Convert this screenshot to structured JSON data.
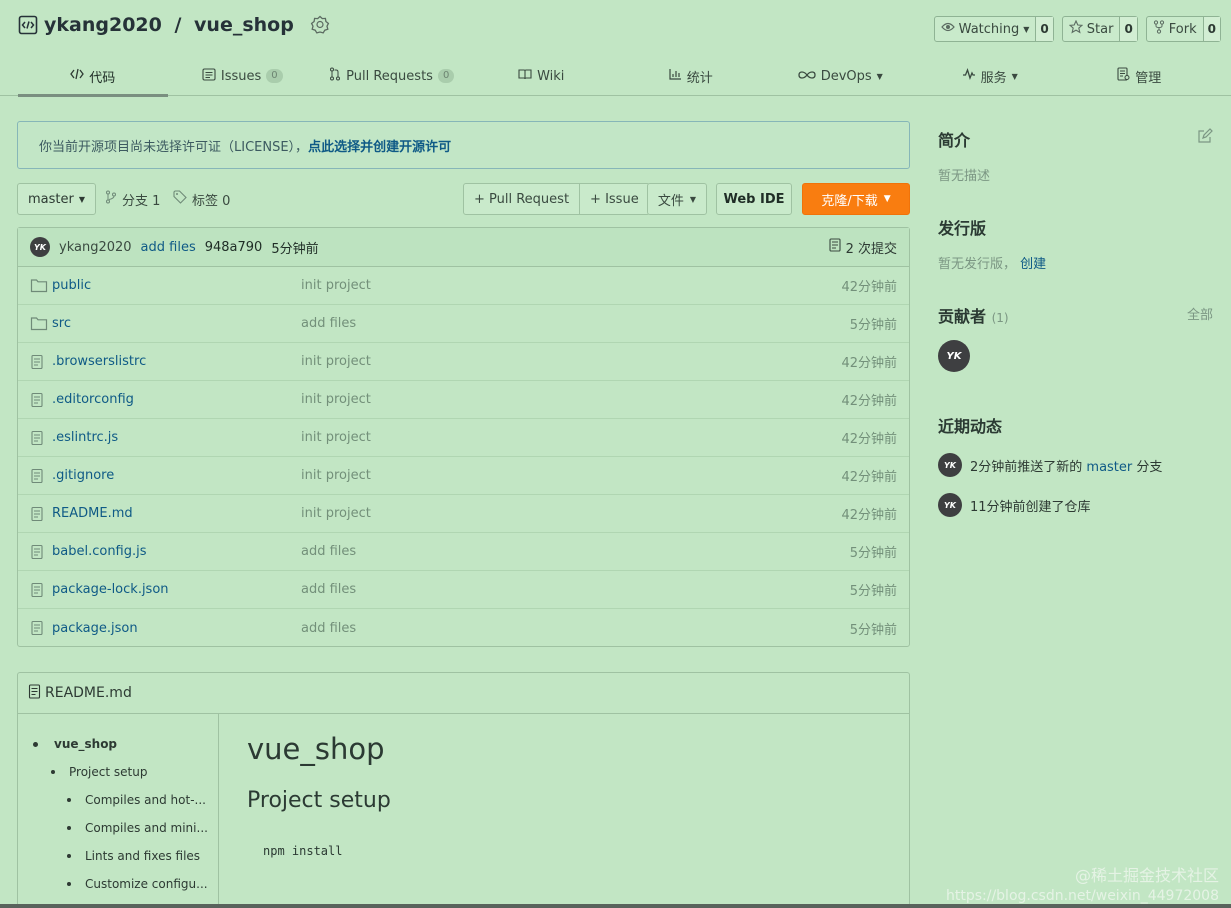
{
  "repo": {
    "owner": "ykang2020",
    "separator": " / ",
    "name": "vue_shop"
  },
  "actions": [
    {
      "label": "Watching",
      "count": "0",
      "icon": "eye-icon",
      "caret": true
    },
    {
      "label": "Star",
      "count": "0",
      "icon": "star-icon",
      "caret": false
    },
    {
      "label": "Fork",
      "count": "0",
      "icon": "fork-icon",
      "caret": false
    }
  ],
  "tabs": [
    {
      "label": "代码",
      "icon": "code-icon"
    },
    {
      "label": "Issues",
      "count": "0",
      "icon": "issues-icon"
    },
    {
      "label": "Pull Requests",
      "count": "0",
      "icon": "pull-request-icon"
    },
    {
      "label": "Wiki",
      "icon": "wiki-icon"
    },
    {
      "label": "统计",
      "icon": "chart-icon"
    },
    {
      "label": "DevOps",
      "icon": "devops-icon"
    },
    {
      "label": "服务",
      "icon": "pulse-icon"
    },
    {
      "label": "管理",
      "icon": "settings-doc-icon"
    }
  ],
  "notice": {
    "text": "你当前开源项目尚未选择许可证（LICENSE），",
    "link": "点此选择并创建开源许可"
  },
  "toolbar": {
    "branch": "master",
    "branches": "分支 1",
    "tags": "标签 0",
    "pull_request": "+ Pull Request",
    "issue": "+ Issue",
    "file": "文件",
    "web_ide": "Web IDE",
    "clone": "克隆/下载"
  },
  "commit": {
    "author": "ykang2020",
    "message": "add files",
    "hash": "948a790",
    "time": "5分钟前",
    "count": "2 次提交"
  },
  "files": [
    {
      "name": "public",
      "type": "folder",
      "message": "init project",
      "time": "42分钟前"
    },
    {
      "name": "src",
      "type": "folder",
      "message": "add files",
      "time": "5分钟前"
    },
    {
      "name": ".browserslistrc",
      "type": "file",
      "message": "init project",
      "time": "42分钟前"
    },
    {
      "name": ".editorconfig",
      "type": "file",
      "message": "init project",
      "time": "42分钟前"
    },
    {
      "name": ".eslintrc.js",
      "type": "file",
      "message": "init project",
      "time": "42分钟前"
    },
    {
      "name": ".gitignore",
      "type": "file",
      "message": "init project",
      "time": "42分钟前"
    },
    {
      "name": "README.md",
      "type": "file",
      "message": "init project",
      "time": "42分钟前"
    },
    {
      "name": "babel.config.js",
      "type": "file",
      "message": "add files",
      "time": "5分钟前"
    },
    {
      "name": "package-lock.json",
      "type": "file",
      "message": "add files",
      "time": "5分钟前"
    },
    {
      "name": "package.json",
      "type": "file",
      "message": "add files",
      "time": "5分钟前"
    }
  ],
  "readme": {
    "title": "README.md",
    "toc": [
      {
        "label": "vue_shop",
        "level": 1
      },
      {
        "label": "Project setup",
        "level": 2
      },
      {
        "label": "Compiles and hot-...",
        "level": 3
      },
      {
        "label": "Compiles and mini...",
        "level": 3
      },
      {
        "label": "Lints and fixes files",
        "level": 3
      },
      {
        "label": "Customize configu...",
        "level": 3
      }
    ],
    "h1": "vue_shop",
    "h2": "Project setup",
    "code": "npm install"
  },
  "sidebar": {
    "intro_title": "简介",
    "intro_text": "暂无描述",
    "release_title": "发行版",
    "release_text": "暂无发行版，",
    "release_link": "创建",
    "contrib_title": "贡献者",
    "contrib_count": "(1)",
    "contrib_all": "全部",
    "activity_title": "近期动态",
    "activities": [
      {
        "pre": "2分钟前推送了新的 ",
        "link": "master",
        "post": " 分支"
      },
      {
        "pre": "11分钟前创建了仓库",
        "link": "",
        "post": ""
      }
    ]
  },
  "avatar_text": "YK",
  "watermark": {
    "line1": "@稀土掘金技术社区",
    "line2": "https://blog.csdn.net/weixin_44972008"
  },
  "colors": {
    "accent": "#f97d10",
    "link": "#0f5a86",
    "background": "#c2e6c4"
  }
}
